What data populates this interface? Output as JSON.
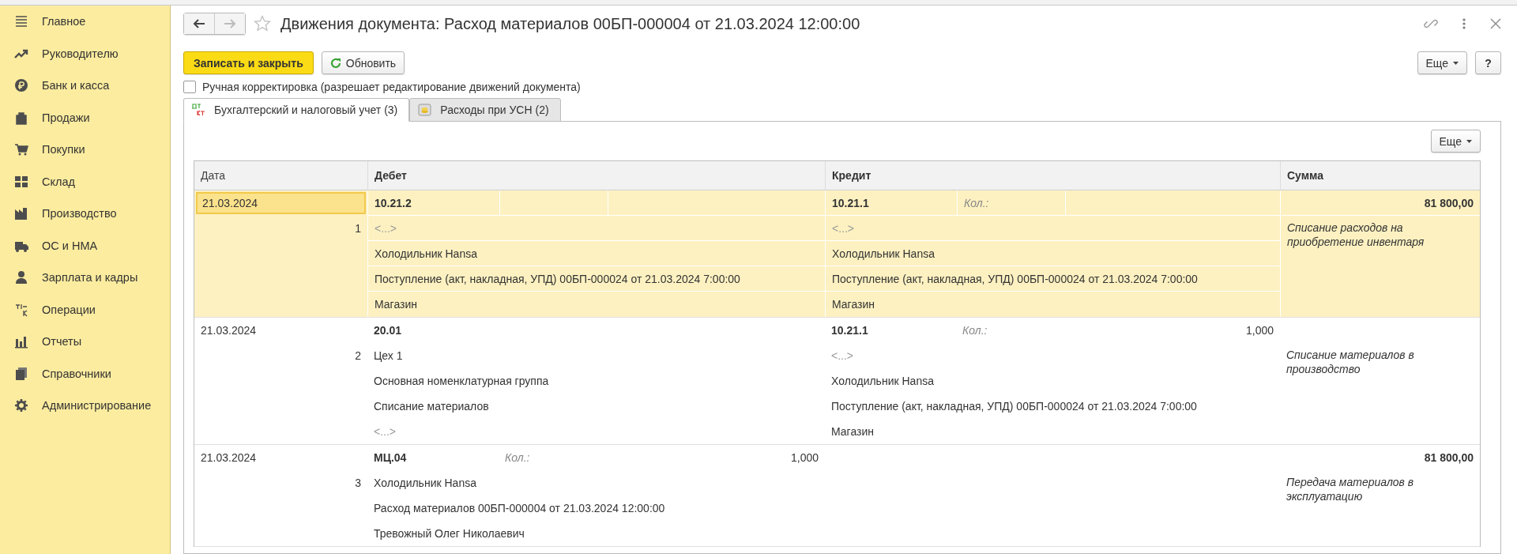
{
  "sidebar": {
    "items": [
      {
        "label": "Главное"
      },
      {
        "label": "Руководителю"
      },
      {
        "label": "Банк и касса"
      },
      {
        "label": "Продажи"
      },
      {
        "label": "Покупки"
      },
      {
        "label": "Склад"
      },
      {
        "label": "Производство"
      },
      {
        "label": "ОС и НМА"
      },
      {
        "label": "Зарплата и кадры"
      },
      {
        "label": "Операции"
      },
      {
        "label": "Отчеты"
      },
      {
        "label": "Справочники"
      },
      {
        "label": "Администрирование"
      }
    ]
  },
  "window": {
    "title": "Движения документа: Расход материалов 00БП-000004 от 21.03.2024 12:00:00"
  },
  "toolbar": {
    "primary": "Записать и закрыть",
    "refresh": "Обновить",
    "more": "Еще",
    "help": "?"
  },
  "manual_edit": {
    "label": "Ручная корректировка (разрешает редактирование движений документа)",
    "checked": false
  },
  "tabs": [
    {
      "label": "Бухгалтерский и налоговый учет (3)",
      "selected": true
    },
    {
      "label": "Расходы при УСН (2)",
      "selected": false
    }
  ],
  "table_toolbar": {
    "more": "Еще"
  },
  "table": {
    "columns": [
      "Дата",
      "Дебет",
      "Кредит",
      "Сумма"
    ],
    "rows": [
      {
        "date": "21.03.2024",
        "number": "1",
        "selected": true,
        "debit": {
          "account": "10.21.2",
          "lines": [
            {
              "text": "<...>",
              "kind": "empty"
            },
            {
              "text": "Холодильник Hansa",
              "kind": "value"
            },
            {
              "text": "Поступление (акт, накладная, УПД) 00БП-000024 от 21.03.2024 7:00:00",
              "kind": "value"
            },
            {
              "text": "Магазин",
              "kind": "value"
            }
          ]
        },
        "credit": {
          "account": "10.21.1",
          "qty_label": "Кол.:",
          "lines": [
            {
              "text": "<...>",
              "kind": "empty"
            },
            {
              "text": "Холодильник Hansa",
              "kind": "value"
            },
            {
              "text": "Поступление (акт, накладная, УПД) 00БП-000024 от 21.03.2024 7:00:00",
              "kind": "value"
            },
            {
              "text": "Магазин",
              "kind": "value"
            }
          ]
        },
        "sum": "81 800,00",
        "content": "Списание расходов на приобретение инвентаря"
      },
      {
        "date": "21.03.2024",
        "number": "2",
        "selected": false,
        "debit": {
          "account": "20.01",
          "lines": [
            {
              "text": "Цех 1",
              "kind": "value"
            },
            {
              "text": "Основная номенклатурная группа",
              "kind": "value"
            },
            {
              "text": "Списание материалов",
              "kind": "value"
            },
            {
              "text": "<...>",
              "kind": "empty"
            }
          ]
        },
        "credit": {
          "account": "10.21.1",
          "qty_label": "Кол.:",
          "qty": "1,000",
          "lines": [
            {
              "text": "<...>",
              "kind": "empty"
            },
            {
              "text": "Холодильник Hansa",
              "kind": "value"
            },
            {
              "text": "Поступление (акт, накладная, УПД) 00БП-000024 от 21.03.2024 7:00:00",
              "kind": "value"
            },
            {
              "text": "Магазин",
              "kind": "value"
            }
          ]
        },
        "content": "Списание материалов в производство"
      },
      {
        "date": "21.03.2024",
        "number": "3",
        "selected": false,
        "debit": {
          "account": "МЦ.04",
          "qty_label": "Кол.:",
          "qty": "1,000",
          "lines": [
            {
              "text": "Холодильник Hansa",
              "kind": "value"
            },
            {
              "text": "Расход материалов 00БП-000004 от 21.03.2024 12:00:00",
              "kind": "value"
            },
            {
              "text": "Тревожный Олег Николаевич",
              "kind": "value"
            }
          ]
        },
        "sum": "81 800,00",
        "content": "Передача материалов в эксплуатацию"
      }
    ]
  }
}
